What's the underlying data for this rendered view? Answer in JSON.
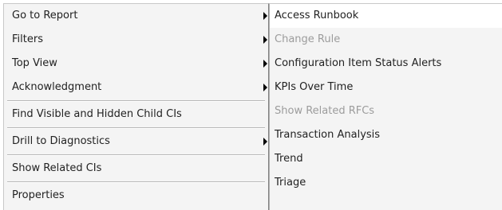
{
  "main_menu": {
    "items": [
      {
        "label": "Go to Report",
        "has_submenu": true
      },
      {
        "label": "Filters",
        "has_submenu": true
      },
      {
        "label": "Top View",
        "has_submenu": true
      },
      {
        "label": "Acknowledgment",
        "has_submenu": true
      },
      {
        "label": "Find Visible and Hidden Child CIs",
        "has_submenu": false
      },
      {
        "label": "Drill to Diagnostics",
        "has_submenu": true
      },
      {
        "label": "Show Related CIs",
        "has_submenu": false
      },
      {
        "label": "Properties",
        "has_submenu": false
      }
    ]
  },
  "sub_menu": {
    "items": [
      {
        "label": "Access Runbook",
        "enabled": true,
        "hovered": true
      },
      {
        "label": "Change Rule",
        "enabled": false
      },
      {
        "label": "Configuration Item Status Alerts",
        "enabled": true
      },
      {
        "label": "KPIs Over Time",
        "enabled": true
      },
      {
        "label": "Show Related RFCs",
        "enabled": false
      },
      {
        "label": "Transaction Analysis",
        "enabled": true
      },
      {
        "label": "Trend",
        "enabled": true
      },
      {
        "label": "Triage",
        "enabled": true
      }
    ]
  },
  "colors": {
    "menu_background": "#f4f4f4",
    "hover_background": "#ffffff",
    "disabled_text": "#9c9c9c",
    "text": "#222222"
  }
}
